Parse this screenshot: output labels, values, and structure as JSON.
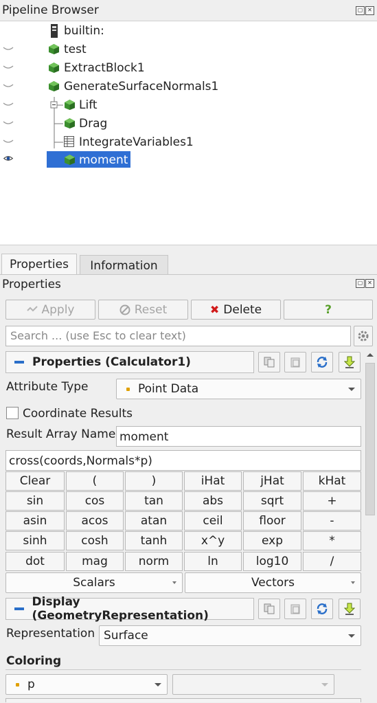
{
  "pipeline_browser": {
    "title": "Pipeline Browser",
    "items": [
      {
        "label": "builtin:",
        "icon": "server-icon",
        "visible": null
      },
      {
        "label": "test",
        "icon": "green-cube-icon",
        "visible": false
      },
      {
        "label": "ExtractBlock1",
        "icon": "green-cube-icon",
        "visible": false
      },
      {
        "label": "GenerateSurfaceNormals1",
        "icon": "green-cube-icon",
        "visible": false
      },
      {
        "label": "Lift",
        "icon": "green-cube-icon",
        "visible": false
      },
      {
        "label": "Drag",
        "icon": "green-cube-icon",
        "visible": false
      },
      {
        "label": "IntegrateVariables1",
        "icon": "spreadsheet-icon",
        "visible": false
      },
      {
        "label": "moment",
        "icon": "green-cube-icon",
        "visible": true,
        "selected": true
      }
    ]
  },
  "tabs": {
    "properties": "Properties",
    "information": "Information"
  },
  "properties_panel": {
    "title": "Properties",
    "apply": "Apply",
    "reset": "Reset",
    "delete": "Delete",
    "help": "?",
    "search_placeholder": "Search ... (use Esc to clear text)",
    "section_properties": "Properties (Calculator1)",
    "attribute_type_label": "Attribute Type",
    "attribute_type_value": "Point Data",
    "coordinate_results_label": "Coordinate Results",
    "result_array_name_label": "Result Array Name",
    "result_array_name_value": "moment",
    "expression": "cross(coords,Normals*p)",
    "calc_buttons": [
      [
        "Clear",
        "(",
        ")",
        "iHat",
        "jHat",
        "kHat"
      ],
      [
        "sin",
        "cos",
        "tan",
        "abs",
        "sqrt",
        "+"
      ],
      [
        "asin",
        "acos",
        "atan",
        "ceil",
        "floor",
        "-"
      ],
      [
        "sinh",
        "cosh",
        "tanh",
        "x^y",
        "exp",
        "*"
      ],
      [
        "dot",
        "mag",
        "norm",
        "ln",
        "log10",
        "/"
      ]
    ],
    "scalars": "Scalars",
    "vectors": "Vectors",
    "section_display": "Display (GeometryRepresentation)",
    "representation_label": "Representation",
    "representation_value": "Surface",
    "coloring_label": "Coloring",
    "coloring_value": "p"
  },
  "colors": {
    "selection": "#2f6fd4",
    "accent_dash": "#2a6fc9",
    "delete_red": "#d11a1a",
    "help_green": "#5aa02c",
    "cube_green": "#3c8f2f"
  }
}
